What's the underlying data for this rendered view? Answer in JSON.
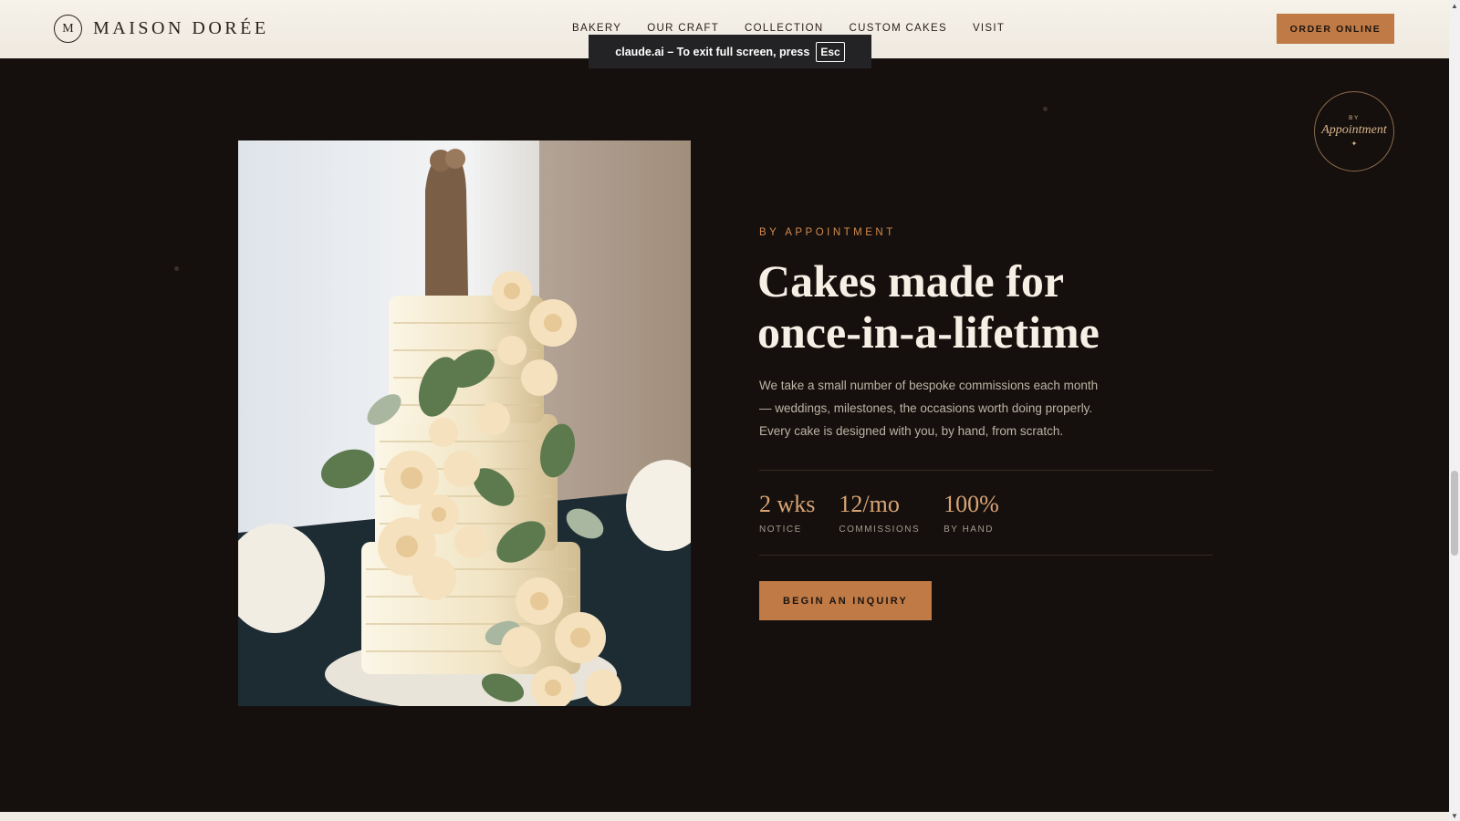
{
  "header": {
    "logo_mark": "M",
    "brand_name": "MAISON DORÉE",
    "nav": [
      {
        "label": "BAKERY"
      },
      {
        "label": "OUR CRAFT"
      },
      {
        "label": "COLLECTION"
      },
      {
        "label": "CUSTOM CAKES"
      },
      {
        "label": "VISIT"
      }
    ],
    "order_button": "ORDER ONLINE"
  },
  "fullscreen_notice": {
    "message": "claude.ai – To exit full screen, press",
    "key": "Esc"
  },
  "badge": {
    "small": "BY",
    "script": "Appointment",
    "ornament": "✦"
  },
  "hero": {
    "eyebrow": "BY APPOINTMENT",
    "headline_line1": "Cakes made for",
    "headline_line2": "once-in-a-lifetime",
    "body": "We take a small number of bespoke commissions each month — weddings, milestones, the occasions worth doing properly. Every cake is designed with you, by hand, from scratch.",
    "stats": [
      {
        "value": "2 wks",
        "label": "NOTICE"
      },
      {
        "value": "12/mo",
        "label": "COMMISSIONS"
      },
      {
        "value": "100%",
        "label": "BY HAND"
      }
    ],
    "cta": "BEGIN AN INQUIRY"
  },
  "theme": {
    "accent": "#c07a45",
    "background": "#15100d",
    "header_bg": "#f6f2ea",
    "headline_color": "#f6efe5"
  },
  "icons": {
    "scroll_up": "▲",
    "scroll_down": "▼"
  }
}
